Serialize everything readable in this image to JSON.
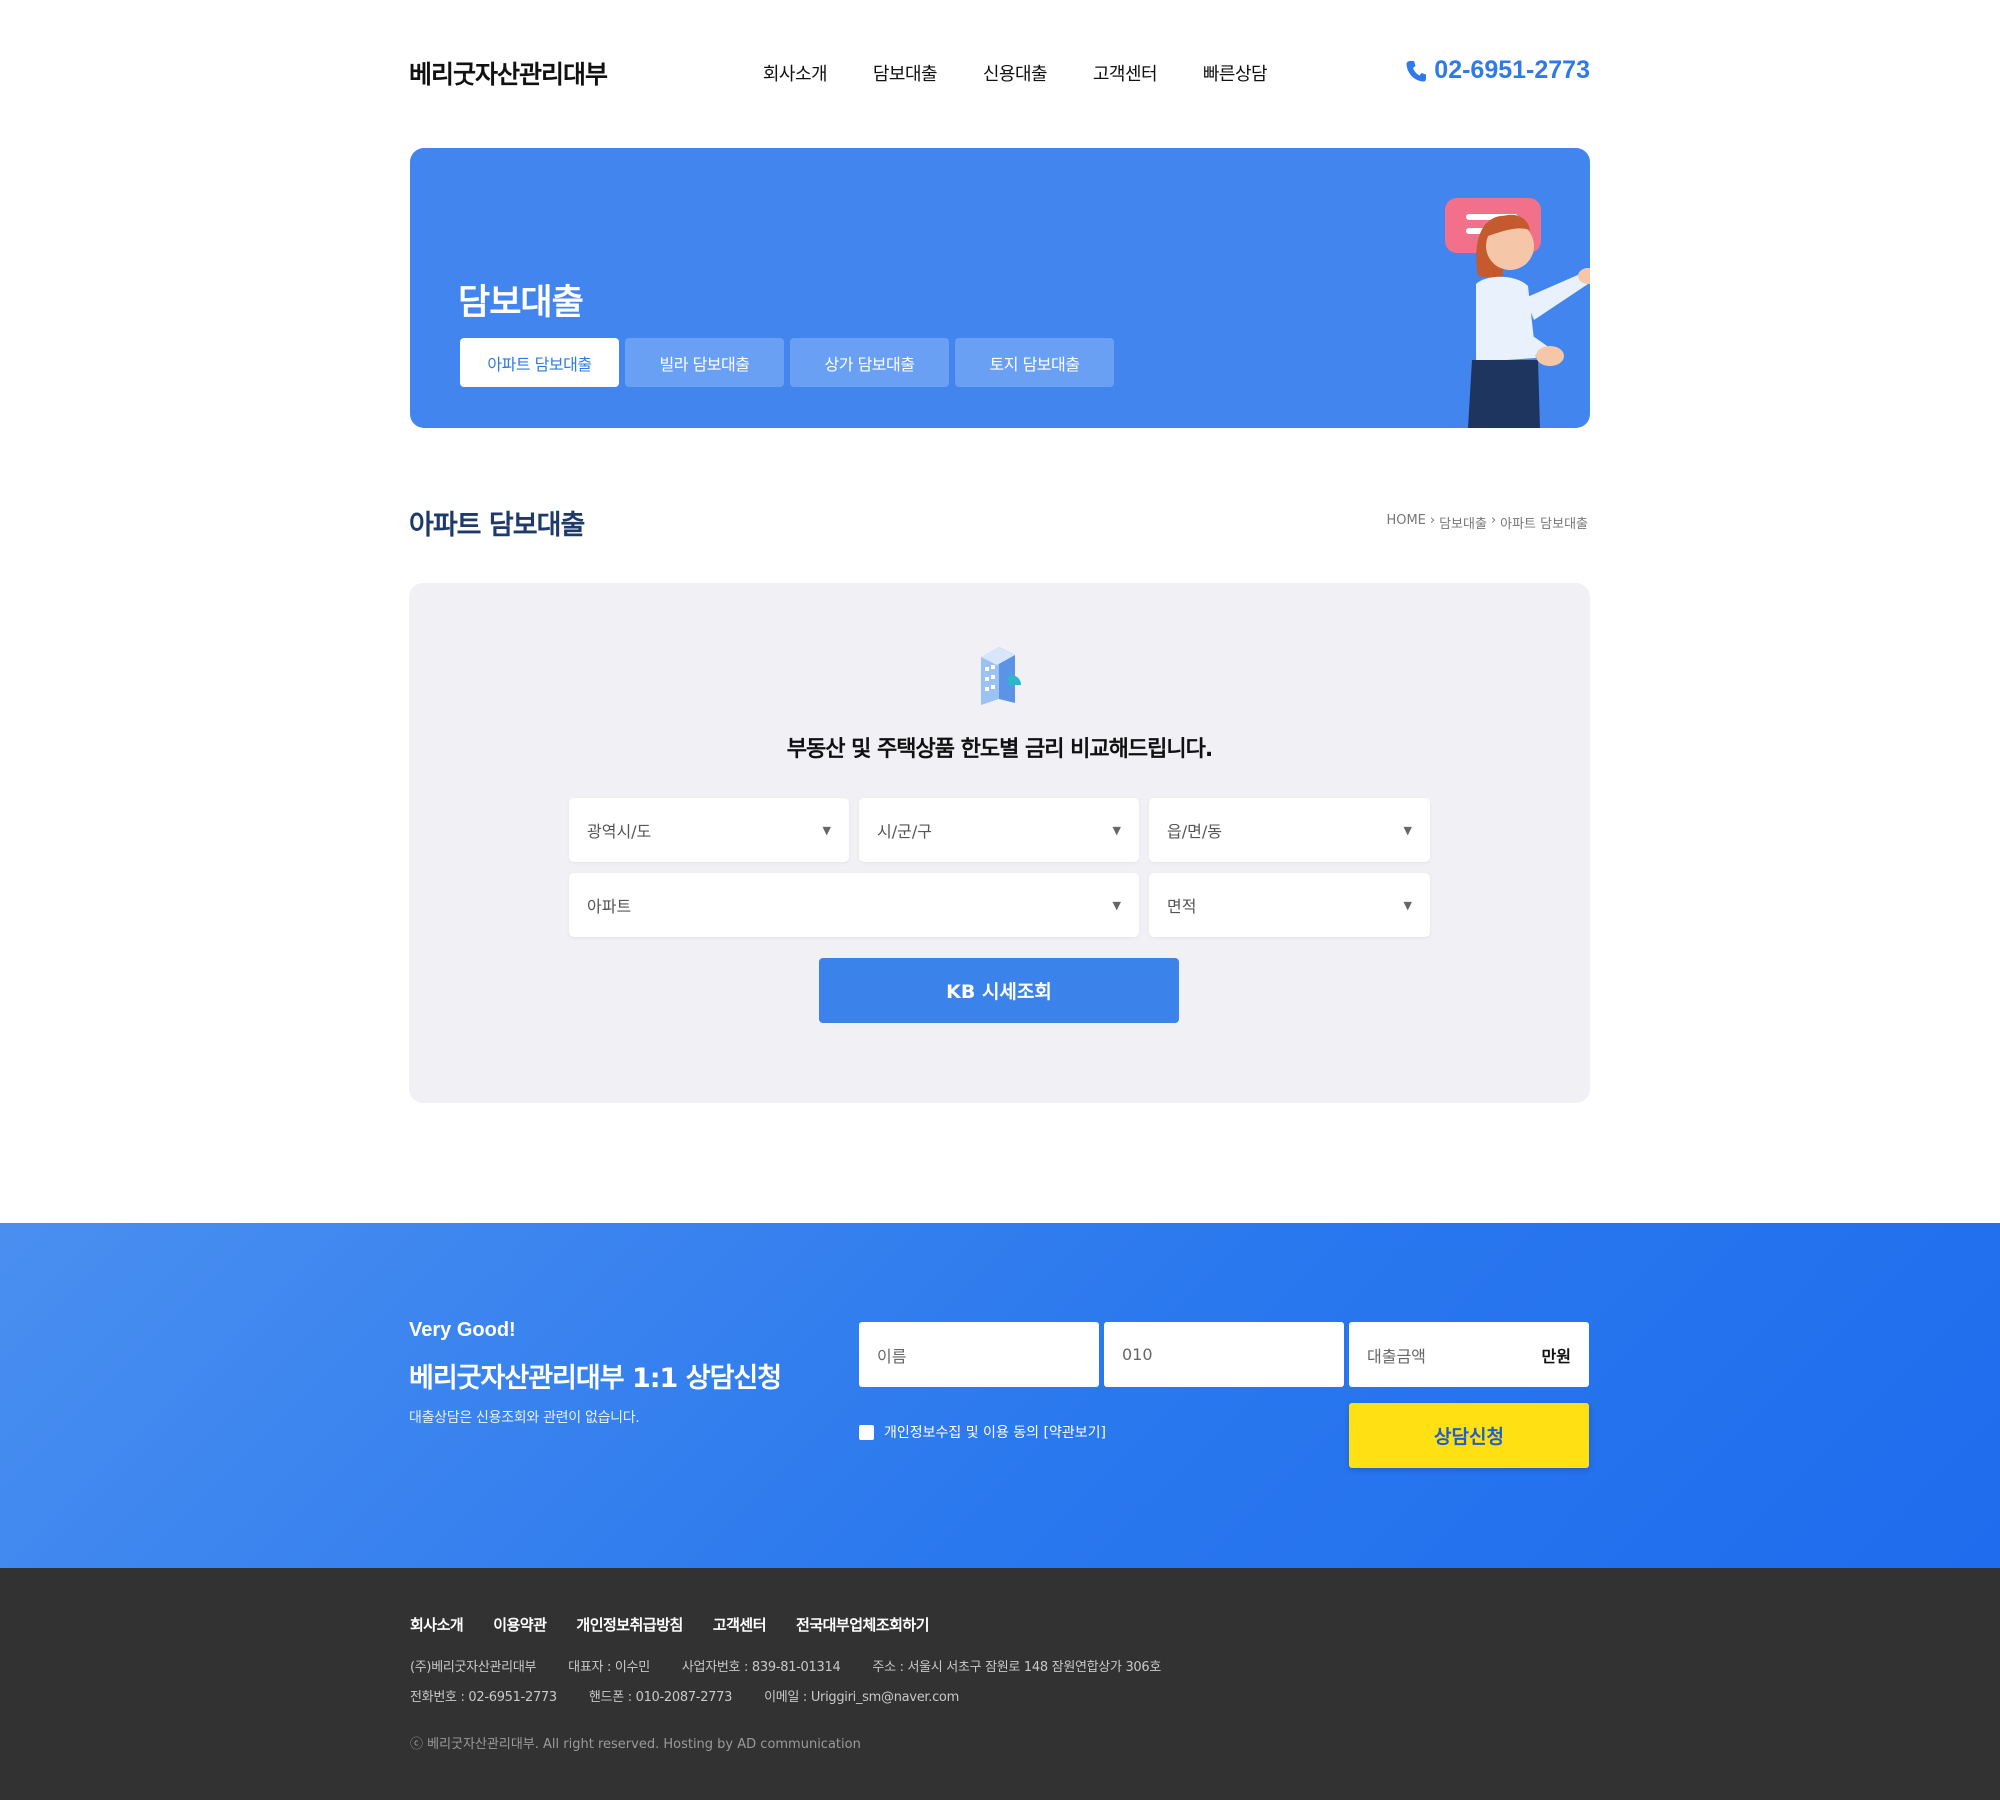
{
  "header": {
    "logo": "베리굿자산관리대부",
    "nav": [
      "회사소개",
      "담보대출",
      "신용대출",
      "고객센터",
      "빠른상담"
    ],
    "phone": "02-6951-2773",
    "accent_color": "#2f79ea"
  },
  "banner": {
    "title": "담보대출",
    "tabs": [
      "아파트 담보대출",
      "빌라 담보대출",
      "상가 담보대출",
      "토지 담보대출"
    ],
    "active_tab": 0,
    "bg_color": "#4285ee"
  },
  "section": {
    "title": "아파트 담보대출",
    "breadcrumb": [
      "HOME",
      "›",
      "담보대출",
      "›",
      "아파트 담보대출"
    ]
  },
  "search": {
    "icon": "building-icon",
    "heading": "부동산 및 주택상품 한도별 금리 비교해드립니다.",
    "selects": {
      "province": "광역시/도",
      "city": "시/군/구",
      "town": "읍/면/동",
      "apartment": "아파트",
      "area": "면적"
    },
    "arrow": "▼",
    "button": "KB 시세조회"
  },
  "consult": {
    "tag": "Very Good!",
    "title": "베리굿자산관리대부 1:1 상담신청",
    "desc": "대출상담은 신용조회와 관련이 없습니다.",
    "name_placeholder": "이름",
    "phone_placeholder": "010",
    "amount_placeholder": "대출금액",
    "amount_unit": "만원",
    "agree_label": "개인정보수집 및 이용 동의 [약관보기]",
    "submit": "상담신청",
    "button_color": "#ffe012"
  },
  "footer": {
    "links": [
      "회사소개",
      "이용약관",
      "개인정보취급방침",
      "고객센터",
      "전국대부업체조회하기"
    ],
    "info_line1": [
      "(주)베리굿자산관리대부",
      "대표자 : 이수민",
      "사업자번호 : 839-81-01314",
      "주소 : 서울시 서초구 잠원로 148 잠원연합상가 306호"
    ],
    "info_line2": [
      "전화번호 : 02-6951-2773",
      "핸드폰 : 010-2087-2773",
      "이메일 : Uriggiri_sm@naver.com"
    ],
    "copyright": "ⓒ 베리굿자산관리대부. All right reserved. Hosting by AD communication"
  }
}
